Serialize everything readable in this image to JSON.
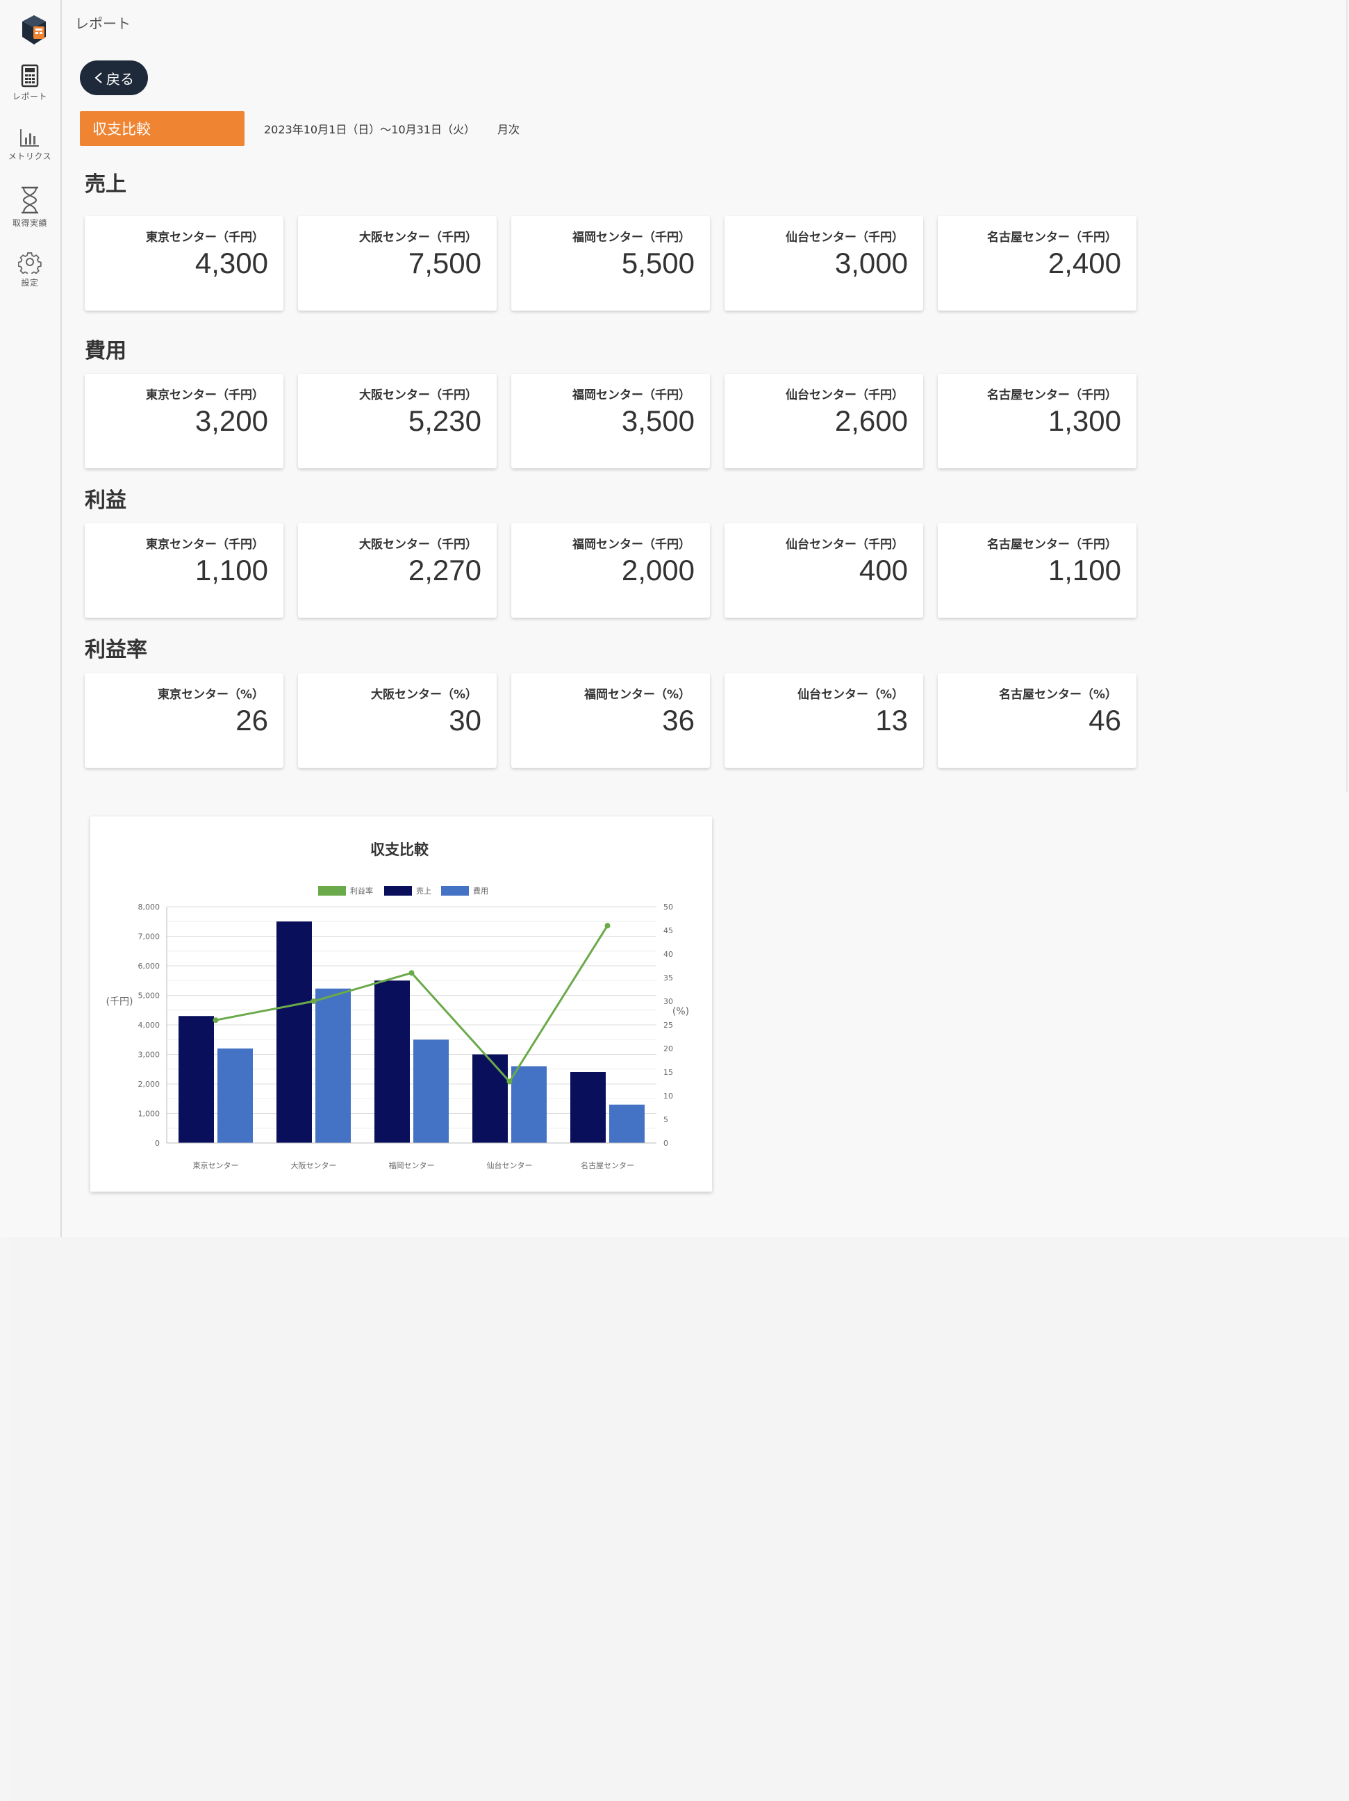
{
  "sidebar": {
    "items": [
      {
        "label": "レポート",
        "icon": "calculator-icon"
      },
      {
        "label": "メトリクス",
        "icon": "bar-chart-icon"
      },
      {
        "label": "取得実績",
        "icon": "hourglass-icon"
      },
      {
        "label": "設定",
        "icon": "gear-icon"
      }
    ]
  },
  "header": {
    "breadcrumb": "レポート",
    "back_label": "戻る",
    "report_tab": "収支比較",
    "date_range": "2023年10月1日（日）〜10月31日（火）",
    "period": "月次"
  },
  "sections": [
    {
      "title": "売上",
      "cards": [
        {
          "label": "東京センター（千円）",
          "value": "4,300"
        },
        {
          "label": "大阪センター（千円）",
          "value": "7,500"
        },
        {
          "label": "福岡センター（千円）",
          "value": "5,500"
        },
        {
          "label": "仙台センター（千円）",
          "value": "3,000"
        },
        {
          "label": "名古屋センター（千円）",
          "value": "2,400"
        }
      ]
    },
    {
      "title": "費用",
      "cards": [
        {
          "label": "東京センター（千円）",
          "value": "3,200"
        },
        {
          "label": "大阪センター（千円）",
          "value": "5,230"
        },
        {
          "label": "福岡センター（千円）",
          "value": "3,500"
        },
        {
          "label": "仙台センター（千円）",
          "value": "2,600"
        },
        {
          "label": "名古屋センター（千円）",
          "value": "1,300"
        }
      ]
    },
    {
      "title": "利益",
      "cards": [
        {
          "label": "東京センター（千円）",
          "value": "1,100"
        },
        {
          "label": "大阪センター（千円）",
          "value": "2,270"
        },
        {
          "label": "福岡センター（千円）",
          "value": "2,000"
        },
        {
          "label": "仙台センター（千円）",
          "value": "400"
        },
        {
          "label": "名古屋センター（千円）",
          "value": "1,100"
        }
      ]
    },
    {
      "title": "利益率",
      "cards": [
        {
          "label": "東京センター（%）",
          "value": "26"
        },
        {
          "label": "大阪センター（%）",
          "value": "30"
        },
        {
          "label": "福岡センター（%）",
          "value": "36"
        },
        {
          "label": "仙台センター（%）",
          "value": "13"
        },
        {
          "label": "名古屋センター（%）",
          "value": "46"
        }
      ]
    }
  ],
  "colors": {
    "accent": "#ef8432",
    "back_button": "#1e2a3a",
    "sales": "#0a0f5c",
    "cost": "#4472c4",
    "margin": "#6aaa4a"
  },
  "chart_data": {
    "type": "bar",
    "title": "収支比較",
    "categories": [
      "東京センター",
      "大阪センター",
      "福岡センター",
      "仙台センター",
      "名古屋センター"
    ],
    "series": [
      {
        "name": "売上",
        "type": "bar",
        "axis": "left",
        "values": [
          4300,
          7500,
          5500,
          3000,
          2400
        ]
      },
      {
        "name": "費用",
        "type": "bar",
        "axis": "left",
        "values": [
          3200,
          5230,
          3500,
          2600,
          1300
        ]
      },
      {
        "name": "利益率",
        "type": "line",
        "axis": "right",
        "values": [
          26,
          30,
          36,
          13,
          46
        ]
      }
    ],
    "legend_order": [
      "利益率",
      "売上",
      "費用"
    ],
    "legend_position": "top",
    "ylabel": "(千円)",
    "y2label": "(%)",
    "ylim": [
      0,
      8000
    ],
    "y2lim": [
      0,
      50
    ],
    "yticks": [
      "0",
      "1,000",
      "2,000",
      "3,000",
      "4,000",
      "5,000",
      "6,000",
      "7,000",
      "8,000"
    ],
    "y2ticks": [
      "0",
      "5",
      "10",
      "15",
      "20",
      "25",
      "30",
      "35",
      "40",
      "45",
      "50"
    ],
    "grid": true
  }
}
